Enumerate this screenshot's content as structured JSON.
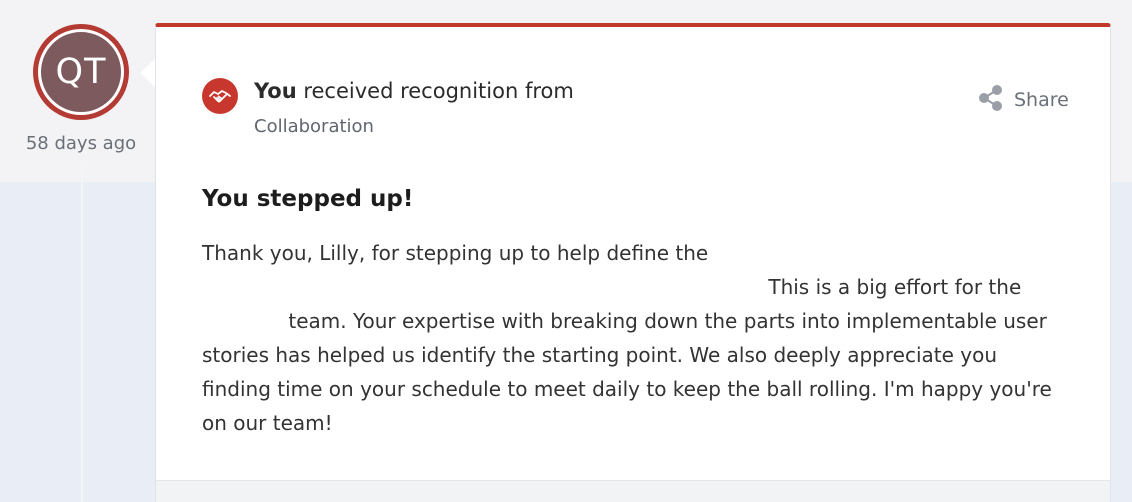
{
  "feed_item": {
    "avatar_initials": "QT",
    "time_ago": "58 days ago",
    "header": {
      "you": "You",
      "received_text": " received recognition from ",
      "giver_name": "",
      "category": "Collaboration"
    },
    "share_label": "Share",
    "title": "You stepped up!",
    "message": {
      "part1": "Thank you, Lilly, for stepping up to help define the ",
      "part2": " This is a big effort for the ",
      "part3": " team. Your expertise with breaking down the parts into implementable user stories has helped us identify the starting point. We also deeply appreciate you finding time on your schedule to meet daily to keep the ball rolling. I'm happy you're on our team!"
    }
  },
  "colors": {
    "accent": "#c0392b",
    "avatar_fill": "#7d5a5e",
    "badge": "#c8372d",
    "muted_text": "#6a6f78"
  },
  "icons": {
    "badge_icon": "handshake-icon",
    "share_icon": "share-icon"
  }
}
